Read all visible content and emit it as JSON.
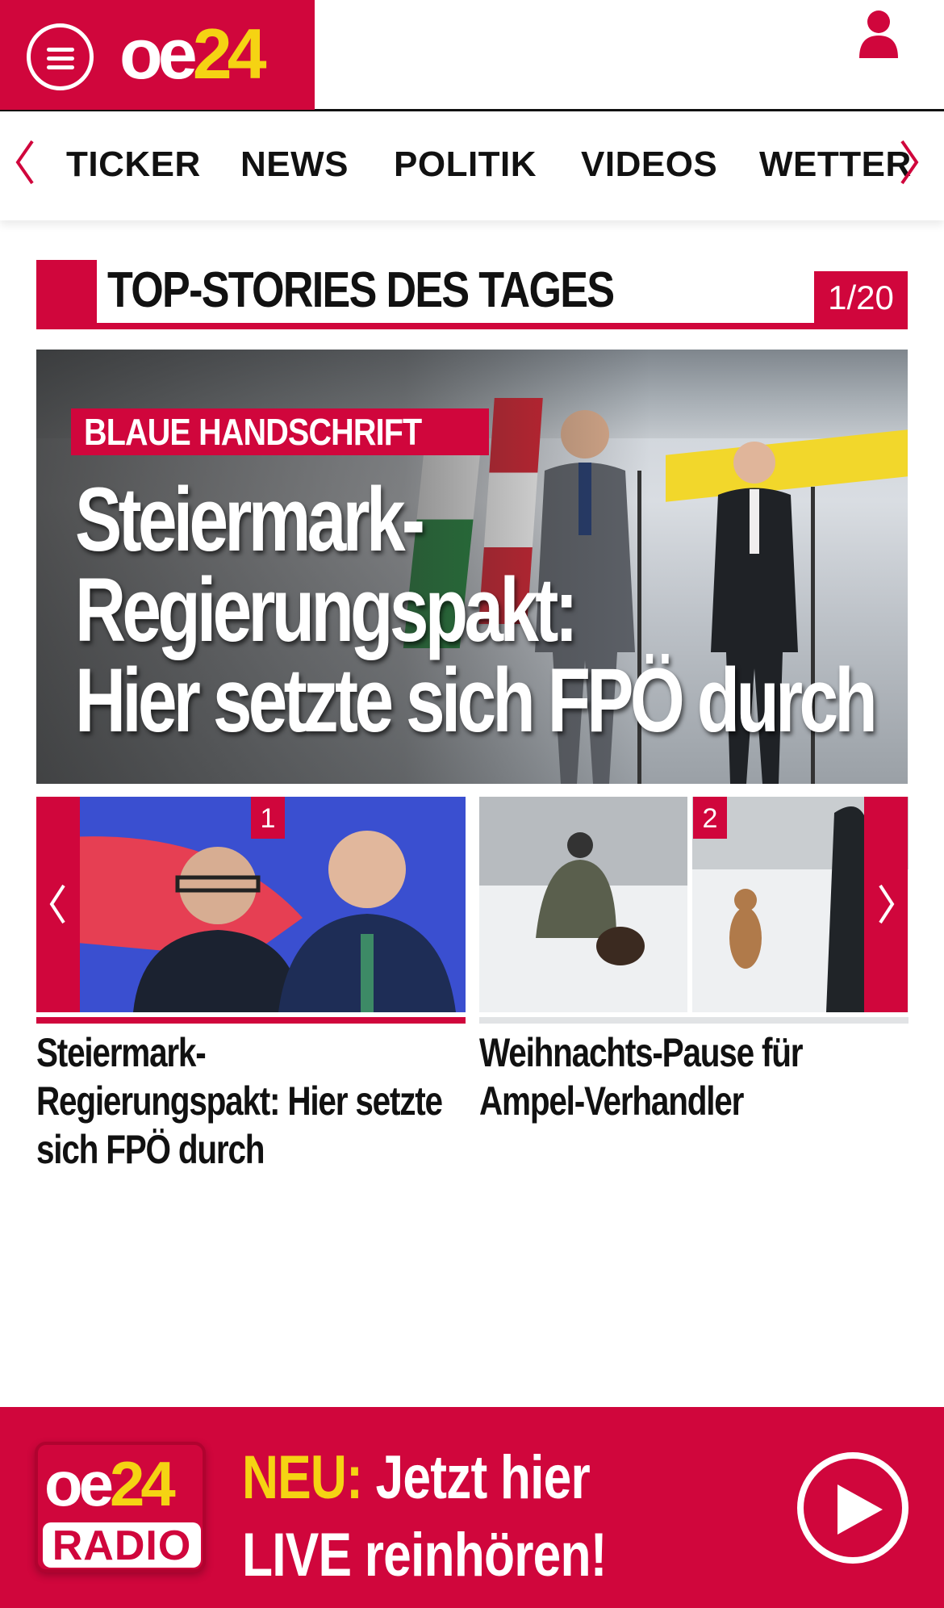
{
  "header": {
    "logo": {
      "oe": "oe",
      "num": "24"
    },
    "menu_icon": "hamburger-icon",
    "user_icon": "user-icon"
  },
  "nav": {
    "items": [
      "TICKER",
      "NEWS",
      "POLITIK",
      "VIDEOS",
      "WETTER"
    ]
  },
  "top_stories": {
    "title": "TOP-STORIES DES TAGES",
    "counter": "1/20",
    "hero": {
      "kicker": "BLAUE HANDSCHRIFT",
      "headline_lines": [
        "Steiermark-",
        "Regierungspakt:",
        "Hier setzte sich FPÖ durch"
      ]
    },
    "cards": [
      {
        "badge": "1",
        "title_lines": [
          "Steiermark-",
          "Regierungspakt: Hier setzte",
          "sich FPÖ durch"
        ]
      },
      {
        "badge": "2",
        "title_lines": [
          "Weihnachts-Pause für",
          "Ampel-Verhandler"
        ]
      }
    ]
  },
  "radio_banner": {
    "logo_top_oe": "oe",
    "logo_top_num": "24",
    "logo_bottom": "RADIO",
    "neu": "NEU:",
    "line1_rest": " Jetzt hier",
    "line2": "LIVE reinhören!"
  },
  "colors": {
    "brand_red": "#d0063c",
    "brand_yellow": "#f5d313"
  }
}
